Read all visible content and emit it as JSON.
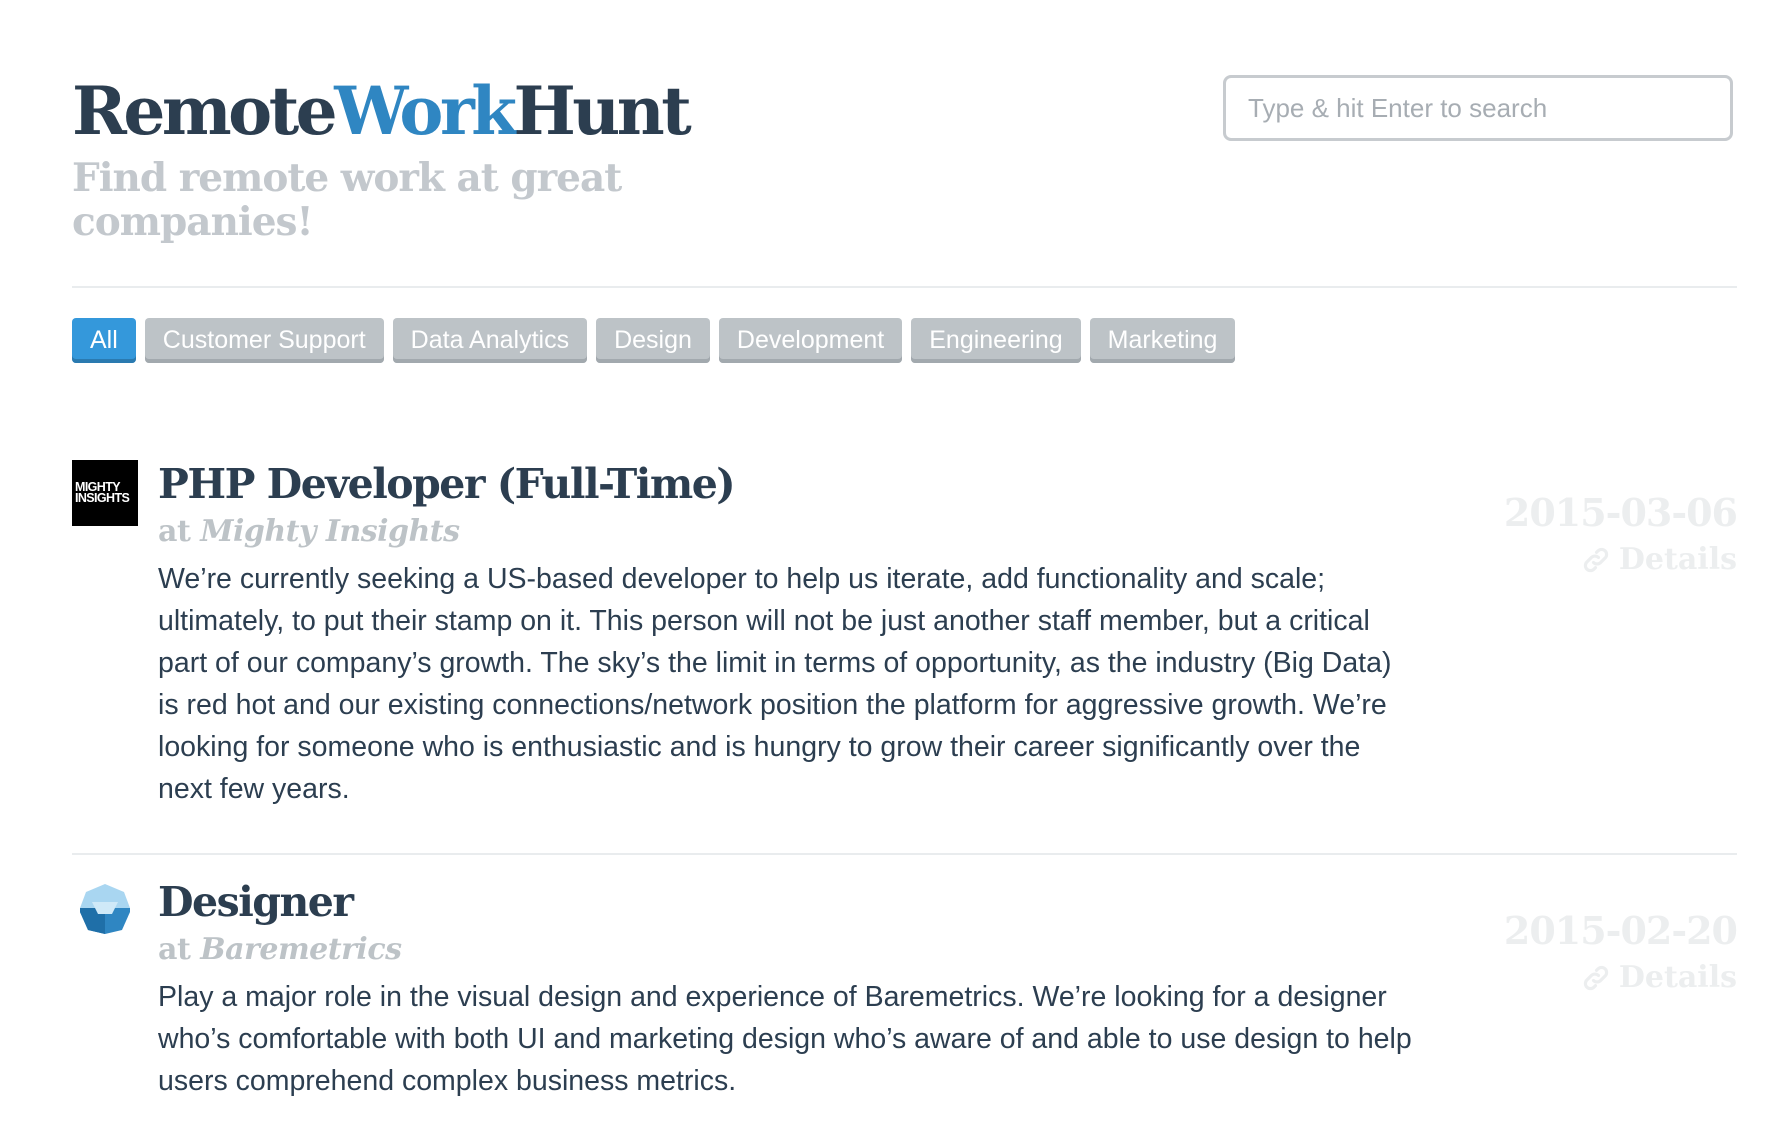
{
  "header": {
    "brand_part1": "Remote",
    "brand_part2": "Work",
    "brand_part3": "Hunt",
    "tagline": "Find remote work at great companies!",
    "search_placeholder": "Type & hit Enter to search"
  },
  "filters": [
    {
      "label": "All",
      "active": true
    },
    {
      "label": "Customer Support",
      "active": false
    },
    {
      "label": "Data Analytics",
      "active": false
    },
    {
      "label": "Design",
      "active": false
    },
    {
      "label": "Development",
      "active": false
    },
    {
      "label": "Engineering",
      "active": false
    },
    {
      "label": "Marketing",
      "active": false
    }
  ],
  "jobs": [
    {
      "title": "PHP Developer (Full-Time)",
      "at": "at",
      "company": "Mighty Insights",
      "logo_text_line1": "MIGHTY",
      "logo_text_line2": "INSIGHTS",
      "description": "We’re currently seeking a US-based developer to help us iterate, add functionality and scale; ultimately, to put their stamp on it. This person will not be just another staff member, but a critical part of our company’s growth. The sky’s the limit in terms of opportunity, as the industry (Big Data) is red hot and our existing connections/network position the platform for aggressive growth. We’re looking for someone who is enthusiastic and is hungry to grow their career significantly over the next few years.",
      "date": "2015-03-06",
      "details_label": "Details",
      "details_icon": "link-icon"
    },
    {
      "title": "Designer",
      "at": "at",
      "company": "Baremetrics",
      "description": "Play a major role in the visual design and experience of Baremetrics. We’re looking for a designer who’s comfortable with both UI and marketing design who’s aware of and able to use design to help users comprehend complex business metrics.",
      "date": "2015-02-20",
      "details_label": "Details",
      "details_icon": "link-icon"
    }
  ],
  "colors": {
    "brand_dark": "#2c3e50",
    "brand_blue": "#2f86c2",
    "filter_active": "#3498db",
    "filter_inactive": "#bdc3c7"
  }
}
